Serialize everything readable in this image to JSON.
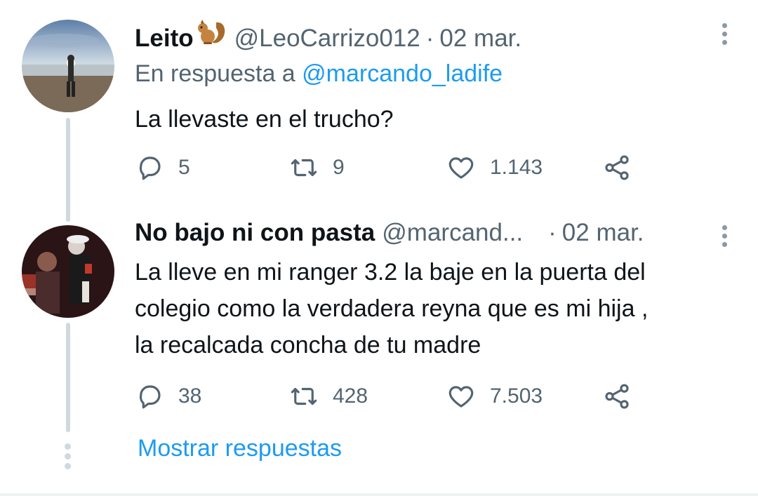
{
  "tweet1": {
    "name": "Leito",
    "handle": "@LeoCarrizo012",
    "separator": "·",
    "date": "02 mar.",
    "reply_prefix": "En respuesta a",
    "reply_handle": "@marcando_ladife",
    "text": "La llevaste en el trucho?",
    "replies": "5",
    "retweets": "9",
    "likes": "1.143"
  },
  "tweet2": {
    "name": "No bajo ni con pasta",
    "handle": "@marcand...",
    "separator": "·",
    "date": "02 mar.",
    "text_line1": "La lleve en mi ranger 3.2 la baje en la puerta del",
    "text_line2": "colegio como la verdadera reyna que es mi hija ,",
    "text_line3": "la recalcada concha de tu madre",
    "replies": "38",
    "retweets": "428",
    "likes": "7.503"
  },
  "show_replies": "Mostrar respuestas",
  "icons": {
    "reply": "reply-icon",
    "retweet": "retweet-icon",
    "like": "heart-icon",
    "share": "share-icon",
    "squirrel": "squirrel-emoji-icon",
    "more": "more-vertical-icon"
  },
  "colors": {
    "link": "#1d9bf0",
    "secondary_text": "#536471",
    "thread_line": "#cfd9de"
  }
}
